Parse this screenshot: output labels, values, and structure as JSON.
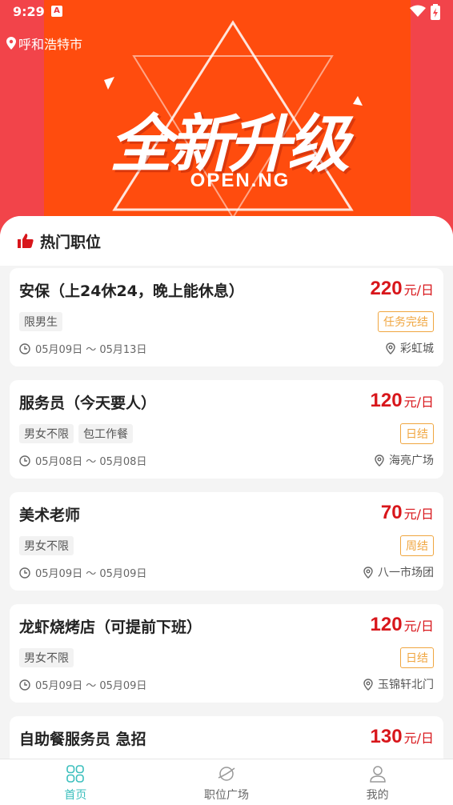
{
  "status_bar": {
    "time": "9:29",
    "notification_icon": "A"
  },
  "location": {
    "city": "呼和浩特市"
  },
  "banner": {
    "headline": "全新升级",
    "subline": "OPEN.NG"
  },
  "section": {
    "title": "热门职位"
  },
  "jobs": [
    {
      "title": "安保（上24休24，晚上能休息）",
      "amount": "220",
      "unit": "元/日",
      "tags": [
        "限男生"
      ],
      "settle": "任务完结",
      "dates": "05月09日 ～ 05月13日",
      "place": "彩虹城"
    },
    {
      "title": "服务员（今天要人）",
      "amount": "120",
      "unit": "元/日",
      "tags": [
        "男女不限",
        "包工作餐"
      ],
      "settle": "日结",
      "dates": "05月08日 ～ 05月08日",
      "place": "海亮广场"
    },
    {
      "title": "美术老师",
      "amount": "70",
      "unit": "元/日",
      "tags": [
        "男女不限"
      ],
      "settle": "周结",
      "dates": "05月09日 ～ 05月09日",
      "place": "八一市场团"
    },
    {
      "title": "龙虾烧烤店（可提前下班）",
      "amount": "120",
      "unit": "元/日",
      "tags": [
        "男女不限"
      ],
      "settle": "日结",
      "dates": "05月09日 ～ 05月09日",
      "place": "玉锦轩北门"
    },
    {
      "title": "自助餐服务员 急招",
      "amount": "130",
      "unit": "元/日"
    }
  ],
  "tabbar": {
    "tabs": [
      {
        "label": "首页",
        "icon": "home-grid-icon",
        "active": true
      },
      {
        "label": "职位广场",
        "icon": "planet-icon",
        "active": false
      },
      {
        "label": "我的",
        "icon": "user-icon",
        "active": false
      }
    ]
  },
  "colors": {
    "accent": "#3bbfbd",
    "price": "#d8161b",
    "settle": "#f0a640",
    "banner_bg": "#f2444a",
    "poster": "#ff4c0e"
  }
}
